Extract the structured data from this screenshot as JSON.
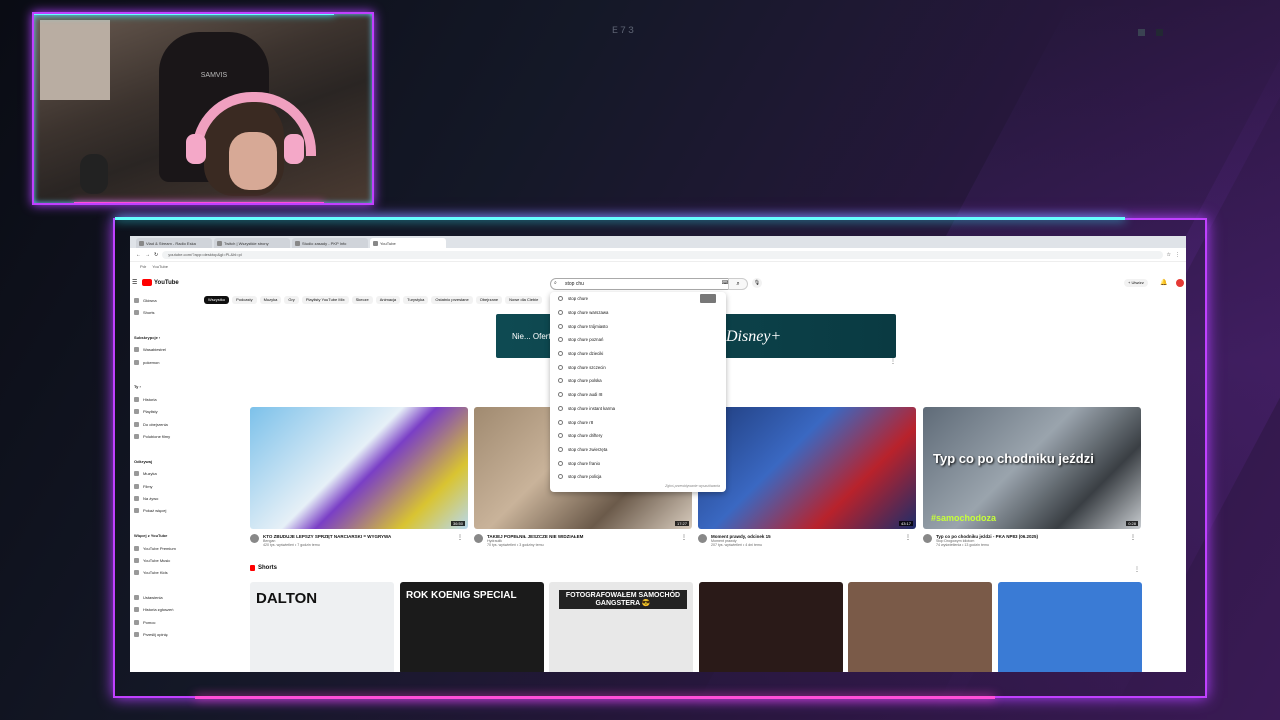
{
  "overlay": {
    "label": "E73"
  },
  "browser": {
    "tabs": [
      {
        "label": "Vlad & Stream - Radio Eska",
        "active": false
      },
      {
        "label": "Twitch | Wszystkie strony",
        "active": false
      },
      {
        "label": "Studio zasady - PKP Info",
        "active": false
      },
      {
        "label": "YouTube",
        "active": true
      }
    ],
    "address": "youtube.com/?app=desktop&gl=PL&hl=pl",
    "bookmarks": [
      "Pdr",
      "YouTube"
    ]
  },
  "youtube": {
    "logo": "YouTube",
    "search_value": "stop chu",
    "create_label": "+ Utwórz",
    "chips": [
      "Wszystko",
      "Podcasty",
      "Muzyka",
      "Gry",
      "Playlisty YouTube Mix",
      "Skecze",
      "Animacja",
      "Turystyka",
      "Ostatnio przesłane",
      "Obejrzane",
      "Nowe dla Ciebie"
    ],
    "sidebar": [
      {
        "label": "Główna",
        "head": false
      },
      {
        "label": "Shorts",
        "head": false
      },
      {
        "label": "",
        "head": false
      },
      {
        "label": "Subskrypcje ›",
        "head": true
      },
      {
        "label": "Wasabiestrel",
        "head": false
      },
      {
        "label": "pokemon",
        "head": false
      },
      {
        "label": "",
        "head": false
      },
      {
        "label": "Ty ›",
        "head": true
      },
      {
        "label": "Historia",
        "head": false
      },
      {
        "label": "Playlisty",
        "head": false
      },
      {
        "label": "Do obejrzenia",
        "head": false
      },
      {
        "label": "Polubione filmy",
        "head": false
      },
      {
        "label": "",
        "head": false
      },
      {
        "label": "Odkrywaj",
        "head": true
      },
      {
        "label": "Muzyka",
        "head": false
      },
      {
        "label": "Filmy",
        "head": false
      },
      {
        "label": "Na żywo",
        "head": false
      },
      {
        "label": "Pokaż więcej",
        "head": false
      },
      {
        "label": "",
        "head": false
      },
      {
        "label": "Więcej z YouTube",
        "head": true
      },
      {
        "label": "YouTube Premium",
        "head": false
      },
      {
        "label": "YouTube Music",
        "head": false
      },
      {
        "label": "YouTube Kids",
        "head": false
      },
      {
        "label": "",
        "head": false
      },
      {
        "label": "Ustawienia",
        "head": false
      },
      {
        "label": "Historia zgłoszeń",
        "head": false
      },
      {
        "label": "Pomoc",
        "head": false
      },
      {
        "label": "Prześlij opinię",
        "head": false
      }
    ],
    "ad": {
      "text": "Nie... Oferta",
      "brand": "Disney+"
    },
    "suggestions": [
      "stop chure",
      "stop chure warszawa",
      "stop chure trójmiasto",
      "stop chure poznań",
      "stop chure dzieciki",
      "stop chure szczecin",
      "stop chure polska",
      "stop chure audi r8",
      "stop chure instant karma",
      "stop chure r8",
      "stop chure driftery",
      "stop chure zwierzęta",
      "stop chure franio",
      "stop chure policja"
    ],
    "suggestions_footer": "Zgłoś przewidywanie wyszukiwania",
    "videos": [
      {
        "title": "KTO ZBUDUJE LEPSZY SPRZĘT NARCIARSKI = WYGRYWA",
        "channel": "Bengan",
        "meta": "420 tys. wyświetleń • 7 godzin temu",
        "duration": "36:50",
        "overlay": "",
        "tag": ""
      },
      {
        "title": "TAKIEJ POPEŁNIŁ JESZCZE NIE WIDZIAŁEM",
        "channel": "Hydraulik",
        "meta": "70 tys. wyświetleń • 3 godziny temu",
        "duration": "17:27",
        "overlay": "",
        "tag": ""
      },
      {
        "title": "Moment prawdy, odcinek 15",
        "channel": "Moment prawdy",
        "meta": "207 tys. wyświetleń • 4 dni temu",
        "duration": "43:17",
        "overlay": "",
        "tag": ""
      },
      {
        "title": "Typ co po chodniku jeździ - PKA NP83 (06.2025)",
        "channel": "Stop Drogowym Idiotom",
        "meta": "74 wyświetlenia • 13 godzin temu",
        "duration": "0:28",
        "overlay": "Typ co po chodniku jeździ",
        "tag": "#samochodoza"
      }
    ],
    "shorts_label": "Shorts",
    "shorts": [
      {
        "caption": "DALTON"
      },
      {
        "caption": "ROK KOENIG SPECIAL"
      },
      {
        "caption": "FOTOGRAFOWAŁEM SAMOCHÓD GANGSTERA 😎"
      },
      {
        "caption": ""
      },
      {
        "caption": ""
      },
      {
        "caption": ""
      }
    ]
  }
}
